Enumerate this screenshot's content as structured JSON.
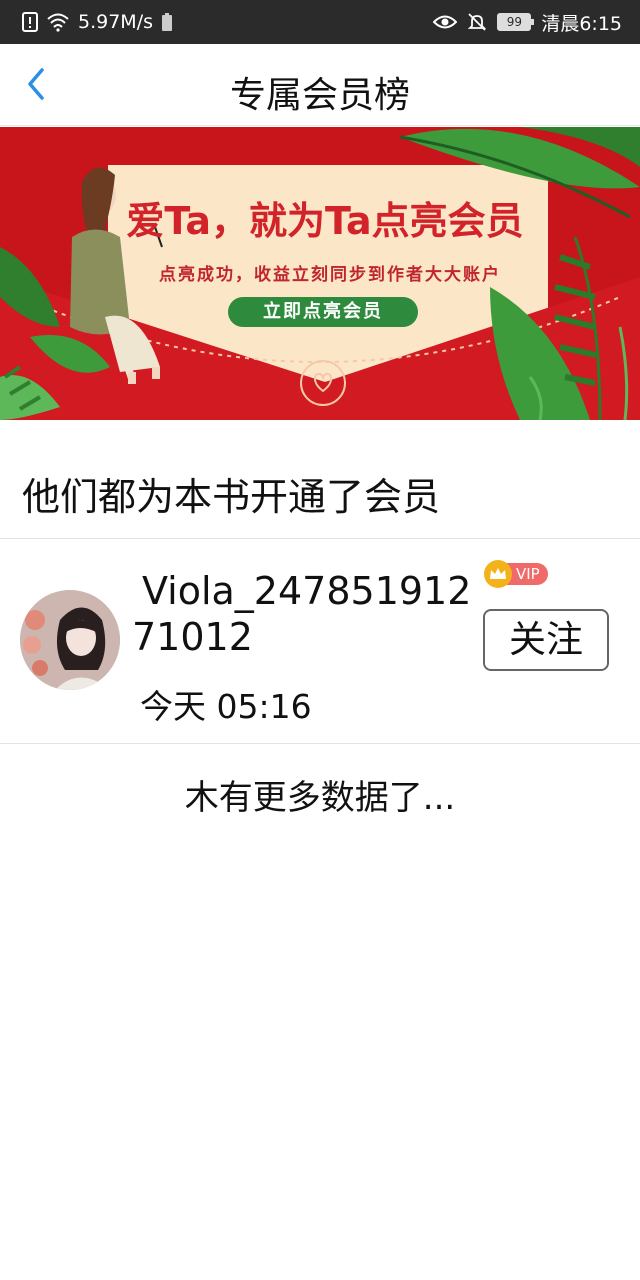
{
  "status_bar": {
    "network_speed": "5.97M/s",
    "battery": "99",
    "time": "清晨6:15"
  },
  "nav": {
    "title": "专属会员榜",
    "back_icon": "chevron-left-icon"
  },
  "banner": {
    "title": "爱Ta，就为Ta点亮会员",
    "subtitle": "点亮成功，收益立刻同步到作者大大账户",
    "button_label": "立即点亮会员"
  },
  "section": {
    "title": "他们都为本书开通了会员"
  },
  "members": [
    {
      "username_line1": "Viola_247851912",
      "username_line2": "71012",
      "badge": "VIP",
      "time": "今天 05:16",
      "follow_label": "关注"
    }
  ],
  "footer": {
    "no_more": "木有更多数据了..."
  },
  "colors": {
    "accent_blue": "#2b8fe8",
    "banner_red": "#c8141b",
    "vip_red": "#f16a6a",
    "vip_gold": "#f3b21a"
  }
}
